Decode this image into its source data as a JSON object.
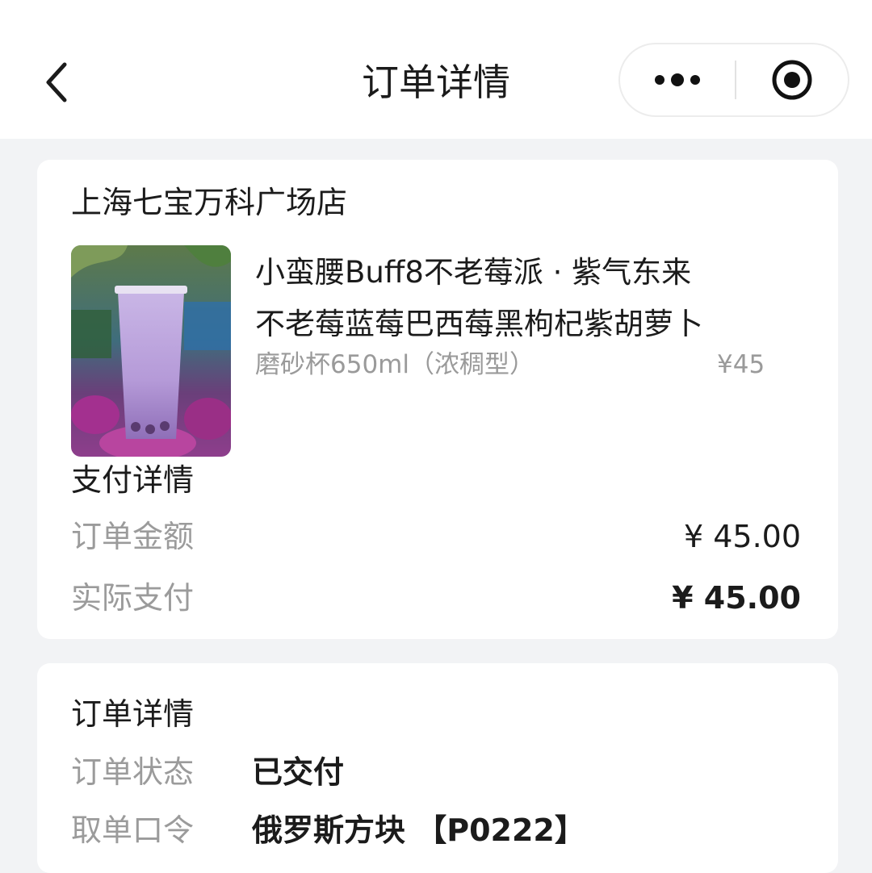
{
  "nav": {
    "title": "订单详情",
    "back_icon": "chevron-left-icon",
    "more_icon": "more-dots-icon",
    "target_icon": "target-icon"
  },
  "store": {
    "name": "上海七宝万科广场店"
  },
  "product": {
    "name_line1": "小蛮腰Buff8不老莓派 · 紫气东来",
    "name_line2": "不老莓蓝莓巴西莓黑枸杞紫胡萝卜",
    "spec": "磨砂杯650ml（浓稠型）",
    "price": "¥45",
    "image": "purple-berry-drink-image"
  },
  "payment": {
    "title": "支付详情",
    "order_amount_label": "订单金额",
    "order_amount_value": "¥ 45.00",
    "actual_paid_label": "实际支付",
    "actual_paid_value": "¥ 45.00"
  },
  "details": {
    "title": "订单详情",
    "status_label": "订单状态",
    "status_value": "已交付",
    "pickup_label": "取单口令",
    "pickup_value": "俄罗斯方块 【P0222】"
  },
  "colors": {
    "background": "#f2f3f5",
    "card": "#ffffff",
    "text_primary": "#1b1b1b",
    "text_secondary": "#9b9b9b",
    "accent_purple": "#b79ad6"
  }
}
